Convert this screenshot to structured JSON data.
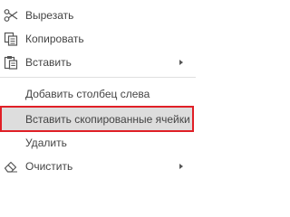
{
  "menu": {
    "items": [
      {
        "label": "Вырезать",
        "icon": "scissors-icon"
      },
      {
        "label": "Копировать",
        "icon": "copy-icon"
      },
      {
        "label": "Вставить",
        "icon": "paste-icon",
        "submenu": true
      },
      {
        "label": "Добавить столбец слева"
      },
      {
        "label": "Вставить скопированные ячейки",
        "highlighted": true
      },
      {
        "label": "Удалить"
      },
      {
        "label": "Очистить",
        "icon": "eraser-icon",
        "submenu": true
      }
    ]
  },
  "colors": {
    "text": "#444444",
    "highlight_bg": "#dddddd",
    "highlight_border": "#e01f26",
    "separator": "#e0e0e0"
  }
}
